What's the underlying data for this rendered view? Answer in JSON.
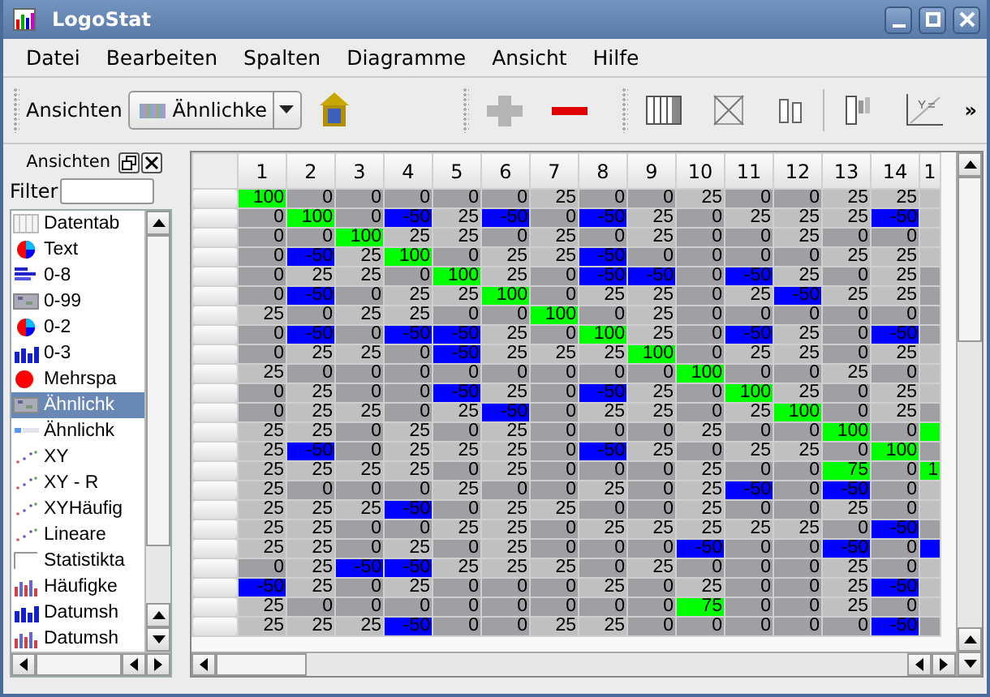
{
  "window": {
    "title": "LogoStat"
  },
  "menu": [
    "Datei",
    "Bearbeiten",
    "Spalten",
    "Diagramme",
    "Ansicht",
    "Hilfe"
  ],
  "toolbar": {
    "label": "Ansichten",
    "combo_value": "Ähnlichke",
    "overflow": "»"
  },
  "panel": {
    "title": "Ansichten",
    "filter_label": "Filter",
    "items": [
      {
        "label": "Datentab",
        "selected": false
      },
      {
        "label": "Text",
        "selected": false
      },
      {
        "label": "0-8",
        "selected": false
      },
      {
        "label": "0-99",
        "selected": false
      },
      {
        "label": "0-2",
        "selected": false
      },
      {
        "label": "0-3",
        "selected": false
      },
      {
        "label": "Mehrspa",
        "selected": false
      },
      {
        "label": "Ähnlichk",
        "selected": true
      },
      {
        "label": "Ähnlichk",
        "selected": false
      },
      {
        "label": "XY",
        "selected": false
      },
      {
        "label": "XY - R",
        "selected": false
      },
      {
        "label": "XYHäufig",
        "selected": false
      },
      {
        "label": "Lineare",
        "selected": false
      },
      {
        "label": "Statistikta",
        "selected": false
      },
      {
        "label": "Häufigke",
        "selected": false
      },
      {
        "label": "Datumsh",
        "selected": false
      },
      {
        "label": "Datumsh",
        "selected": false
      }
    ]
  },
  "table": {
    "columns": [
      "1",
      "2",
      "3",
      "4",
      "5",
      "6",
      "7",
      "8",
      "9",
      "10",
      "11",
      "12",
      "13",
      "14",
      "1"
    ],
    "rows": [
      {
        "cells": [
          {
            "value": "100",
            "color": "#00ff00"
          },
          {
            "value": "0",
            "color": "#a0a0a4"
          },
          {
            "value": "0",
            "color": "#a0a0a4"
          },
          {
            "value": "0",
            "color": "#a0a0a4"
          },
          {
            "value": "0",
            "color": "#a0a0a4"
          },
          {
            "value": "0",
            "color": "#a0a0a4"
          },
          {
            "value": "25",
            "color": "#c0c0c0"
          },
          {
            "value": "0",
            "color": "#a0a0a4"
          },
          {
            "value": "0",
            "color": "#a0a0a4"
          },
          {
            "value": "25",
            "color": "#c0c0c0"
          },
          {
            "value": "0",
            "color": "#a0a0a4"
          },
          {
            "value": "0",
            "color": "#a0a0a4"
          },
          {
            "value": "25",
            "color": "#c0c0c0"
          },
          {
            "value": "25",
            "color": "#c0c0c0"
          },
          {
            "color": "#c0c0c0"
          }
        ]
      },
      {
        "cells": [
          {
            "value": "0",
            "color": "#a0a0a4"
          },
          {
            "value": "100",
            "color": "#00ff00"
          },
          {
            "value": "0",
            "color": "#a0a0a4"
          },
          {
            "value": "-50",
            "color": "#0000ff"
          },
          {
            "value": "25",
            "color": "#c0c0c0"
          },
          {
            "value": "-50",
            "color": "#0000ff"
          },
          {
            "value": "0",
            "color": "#a0a0a4"
          },
          {
            "value": "-50",
            "color": "#0000ff"
          },
          {
            "value": "25",
            "color": "#c0c0c0"
          },
          {
            "value": "0",
            "color": "#a0a0a4"
          },
          {
            "value": "25",
            "color": "#c0c0c0"
          },
          {
            "value": "25",
            "color": "#c0c0c0"
          },
          {
            "value": "25",
            "color": "#c0c0c0"
          },
          {
            "value": "-50",
            "color": "#0000ff"
          },
          {
            "color": "#c0c0c0"
          }
        ]
      },
      {
        "cells": [
          {
            "value": "0",
            "color": "#a0a0a4"
          },
          {
            "value": "0",
            "color": "#a0a0a4"
          },
          {
            "value": "100",
            "color": "#00ff00"
          },
          {
            "value": "25",
            "color": "#c0c0c0"
          },
          {
            "value": "25",
            "color": "#c0c0c0"
          },
          {
            "value": "0",
            "color": "#a0a0a4"
          },
          {
            "value": "25",
            "color": "#c0c0c0"
          },
          {
            "value": "0",
            "color": "#a0a0a4"
          },
          {
            "value": "25",
            "color": "#c0c0c0"
          },
          {
            "value": "0",
            "color": "#a0a0a4"
          },
          {
            "value": "0",
            "color": "#a0a0a4"
          },
          {
            "value": "25",
            "color": "#c0c0c0"
          },
          {
            "value": "0",
            "color": "#a0a0a4"
          },
          {
            "value": "0",
            "color": "#a0a0a4"
          },
          {
            "color": "#c0c0c0"
          }
        ]
      },
      {
        "cells": [
          {
            "value": "0",
            "color": "#a0a0a4"
          },
          {
            "value": "-50",
            "color": "#0000ff"
          },
          {
            "value": "25",
            "color": "#c0c0c0"
          },
          {
            "value": "100",
            "color": "#00ff00"
          },
          {
            "value": "0",
            "color": "#a0a0a4"
          },
          {
            "value": "25",
            "color": "#c0c0c0"
          },
          {
            "value": "25",
            "color": "#c0c0c0"
          },
          {
            "value": "-50",
            "color": "#0000ff"
          },
          {
            "value": "0",
            "color": "#a0a0a4"
          },
          {
            "value": "0",
            "color": "#a0a0a4"
          },
          {
            "value": "0",
            "color": "#a0a0a4"
          },
          {
            "value": "0",
            "color": "#a0a0a4"
          },
          {
            "value": "25",
            "color": "#c0c0c0"
          },
          {
            "value": "25",
            "color": "#c0c0c0"
          },
          {
            "color": "#c0c0c0"
          }
        ]
      },
      {
        "cells": [
          {
            "value": "0",
            "color": "#a0a0a4"
          },
          {
            "value": "25",
            "color": "#c0c0c0"
          },
          {
            "value": "25",
            "color": "#c0c0c0"
          },
          {
            "value": "0",
            "color": "#a0a0a4"
          },
          {
            "value": "100",
            "color": "#00ff00"
          },
          {
            "value": "25",
            "color": "#c0c0c0"
          },
          {
            "value": "0",
            "color": "#a0a0a4"
          },
          {
            "value": "-50",
            "color": "#0000ff"
          },
          {
            "value": "-50",
            "color": "#0000ff"
          },
          {
            "value": "0",
            "color": "#a0a0a4"
          },
          {
            "value": "-50",
            "color": "#0000ff"
          },
          {
            "value": "25",
            "color": "#c0c0c0"
          },
          {
            "value": "0",
            "color": "#a0a0a4"
          },
          {
            "value": "25",
            "color": "#c0c0c0"
          },
          {
            "color": "#a0a0a4"
          }
        ]
      },
      {
        "cells": [
          {
            "value": "0",
            "color": "#a0a0a4"
          },
          {
            "value": "-50",
            "color": "#0000ff"
          },
          {
            "value": "0",
            "color": "#a0a0a4"
          },
          {
            "value": "25",
            "color": "#c0c0c0"
          },
          {
            "value": "25",
            "color": "#c0c0c0"
          },
          {
            "value": "100",
            "color": "#00ff00"
          },
          {
            "value": "0",
            "color": "#a0a0a4"
          },
          {
            "value": "25",
            "color": "#c0c0c0"
          },
          {
            "value": "25",
            "color": "#c0c0c0"
          },
          {
            "value": "0",
            "color": "#a0a0a4"
          },
          {
            "value": "25",
            "color": "#c0c0c0"
          },
          {
            "value": "-50",
            "color": "#0000ff"
          },
          {
            "value": "25",
            "color": "#c0c0c0"
          },
          {
            "value": "25",
            "color": "#c0c0c0"
          },
          {
            "color": "#a0a0a4"
          }
        ]
      },
      {
        "cells": [
          {
            "value": "25",
            "color": "#c0c0c0"
          },
          {
            "value": "0",
            "color": "#a0a0a4"
          },
          {
            "value": "25",
            "color": "#c0c0c0"
          },
          {
            "value": "25",
            "color": "#c0c0c0"
          },
          {
            "value": "0",
            "color": "#a0a0a4"
          },
          {
            "value": "0",
            "color": "#a0a0a4"
          },
          {
            "value": "100",
            "color": "#00ff00"
          },
          {
            "value": "0",
            "color": "#a0a0a4"
          },
          {
            "value": "25",
            "color": "#c0c0c0"
          },
          {
            "value": "0",
            "color": "#a0a0a4"
          },
          {
            "value": "0",
            "color": "#a0a0a4"
          },
          {
            "value": "0",
            "color": "#a0a0a4"
          },
          {
            "value": "0",
            "color": "#a0a0a4"
          },
          {
            "value": "0",
            "color": "#a0a0a4"
          },
          {
            "color": "#a0a0a4"
          }
        ]
      },
      {
        "cells": [
          {
            "value": "0",
            "color": "#a0a0a4"
          },
          {
            "value": "-50",
            "color": "#0000ff"
          },
          {
            "value": "0",
            "color": "#a0a0a4"
          },
          {
            "value": "-50",
            "color": "#0000ff"
          },
          {
            "value": "-50",
            "color": "#0000ff"
          },
          {
            "value": "25",
            "color": "#c0c0c0"
          },
          {
            "value": "0",
            "color": "#a0a0a4"
          },
          {
            "value": "100",
            "color": "#00ff00"
          },
          {
            "value": "25",
            "color": "#c0c0c0"
          },
          {
            "value": "0",
            "color": "#a0a0a4"
          },
          {
            "value": "-50",
            "color": "#0000ff"
          },
          {
            "value": "25",
            "color": "#c0c0c0"
          },
          {
            "value": "0",
            "color": "#a0a0a4"
          },
          {
            "value": "-50",
            "color": "#0000ff"
          },
          {
            "color": "#a0a0a4"
          }
        ]
      },
      {
        "cells": [
          {
            "value": "0",
            "color": "#a0a0a4"
          },
          {
            "value": "25",
            "color": "#c0c0c0"
          },
          {
            "value": "25",
            "color": "#c0c0c0"
          },
          {
            "value": "0",
            "color": "#a0a0a4"
          },
          {
            "value": "-50",
            "color": "#0000ff"
          },
          {
            "value": "25",
            "color": "#c0c0c0"
          },
          {
            "value": "25",
            "color": "#c0c0c0"
          },
          {
            "value": "25",
            "color": "#c0c0c0"
          },
          {
            "value": "100",
            "color": "#00ff00"
          },
          {
            "value": "0",
            "color": "#a0a0a4"
          },
          {
            "value": "25",
            "color": "#c0c0c0"
          },
          {
            "value": "25",
            "color": "#c0c0c0"
          },
          {
            "value": "0",
            "color": "#a0a0a4"
          },
          {
            "value": "25",
            "color": "#c0c0c0"
          },
          {
            "color": "#c0c0c0"
          }
        ]
      },
      {
        "cells": [
          {
            "value": "25",
            "color": "#c0c0c0"
          },
          {
            "value": "0",
            "color": "#a0a0a4"
          },
          {
            "value": "0",
            "color": "#a0a0a4"
          },
          {
            "value": "0",
            "color": "#a0a0a4"
          },
          {
            "value": "0",
            "color": "#a0a0a4"
          },
          {
            "value": "0",
            "color": "#a0a0a4"
          },
          {
            "value": "0",
            "color": "#a0a0a4"
          },
          {
            "value": "0",
            "color": "#a0a0a4"
          },
          {
            "value": "0",
            "color": "#a0a0a4"
          },
          {
            "value": "100",
            "color": "#00ff00"
          },
          {
            "value": "0",
            "color": "#a0a0a4"
          },
          {
            "value": "0",
            "color": "#a0a0a4"
          },
          {
            "value": "25",
            "color": "#c0c0c0"
          },
          {
            "value": "0",
            "color": "#a0a0a4"
          },
          {
            "color": "#c0c0c0"
          }
        ]
      },
      {
        "cells": [
          {
            "value": "0",
            "color": "#a0a0a4"
          },
          {
            "value": "25",
            "color": "#c0c0c0"
          },
          {
            "value": "0",
            "color": "#a0a0a4"
          },
          {
            "value": "0",
            "color": "#a0a0a4"
          },
          {
            "value": "-50",
            "color": "#0000ff"
          },
          {
            "value": "25",
            "color": "#c0c0c0"
          },
          {
            "value": "0",
            "color": "#a0a0a4"
          },
          {
            "value": "-50",
            "color": "#0000ff"
          },
          {
            "value": "25",
            "color": "#c0c0c0"
          },
          {
            "value": "0",
            "color": "#a0a0a4"
          },
          {
            "value": "100",
            "color": "#00ff00"
          },
          {
            "value": "25",
            "color": "#c0c0c0"
          },
          {
            "value": "0",
            "color": "#a0a0a4"
          },
          {
            "value": "25",
            "color": "#c0c0c0"
          },
          {
            "color": "#c0c0c0"
          }
        ]
      },
      {
        "cells": [
          {
            "value": "0",
            "color": "#a0a0a4"
          },
          {
            "value": "25",
            "color": "#c0c0c0"
          },
          {
            "value": "25",
            "color": "#c0c0c0"
          },
          {
            "value": "0",
            "color": "#a0a0a4"
          },
          {
            "value": "25",
            "color": "#c0c0c0"
          },
          {
            "value": "-50",
            "color": "#0000ff"
          },
          {
            "value": "0",
            "color": "#a0a0a4"
          },
          {
            "value": "25",
            "color": "#c0c0c0"
          },
          {
            "value": "25",
            "color": "#c0c0c0"
          },
          {
            "value": "0",
            "color": "#a0a0a4"
          },
          {
            "value": "25",
            "color": "#c0c0c0"
          },
          {
            "value": "100",
            "color": "#00ff00"
          },
          {
            "value": "0",
            "color": "#a0a0a4"
          },
          {
            "value": "25",
            "color": "#c0c0c0"
          },
          {
            "color": "#a0a0a4"
          }
        ]
      },
      {
        "cells": [
          {
            "value": "25",
            "color": "#c0c0c0"
          },
          {
            "value": "25",
            "color": "#c0c0c0"
          },
          {
            "value": "0",
            "color": "#a0a0a4"
          },
          {
            "value": "25",
            "color": "#c0c0c0"
          },
          {
            "value": "0",
            "color": "#a0a0a4"
          },
          {
            "value": "25",
            "color": "#c0c0c0"
          },
          {
            "value": "0",
            "color": "#a0a0a4"
          },
          {
            "value": "0",
            "color": "#a0a0a4"
          },
          {
            "value": "0",
            "color": "#a0a0a4"
          },
          {
            "value": "25",
            "color": "#c0c0c0"
          },
          {
            "value": "0",
            "color": "#a0a0a4"
          },
          {
            "value": "0",
            "color": "#a0a0a4"
          },
          {
            "value": "100",
            "color": "#00ff00"
          },
          {
            "value": "0",
            "color": "#a0a0a4"
          },
          {
            "color": "#00ff00"
          }
        ]
      },
      {
        "cells": [
          {
            "value": "25",
            "color": "#c0c0c0"
          },
          {
            "value": "-50",
            "color": "#0000ff"
          },
          {
            "value": "0",
            "color": "#a0a0a4"
          },
          {
            "value": "25",
            "color": "#c0c0c0"
          },
          {
            "value": "25",
            "color": "#c0c0c0"
          },
          {
            "value": "25",
            "color": "#c0c0c0"
          },
          {
            "value": "0",
            "color": "#a0a0a4"
          },
          {
            "value": "-50",
            "color": "#0000ff"
          },
          {
            "value": "25",
            "color": "#c0c0c0"
          },
          {
            "value": "0",
            "color": "#a0a0a4"
          },
          {
            "value": "25",
            "color": "#c0c0c0"
          },
          {
            "value": "25",
            "color": "#c0c0c0"
          },
          {
            "value": "0",
            "color": "#a0a0a4"
          },
          {
            "value": "100",
            "color": "#00ff00"
          },
          {
            "color": "#a0a0a4"
          }
        ]
      },
      {
        "cells": [
          {
            "value": "25",
            "color": "#c0c0c0"
          },
          {
            "value": "25",
            "color": "#c0c0c0"
          },
          {
            "value": "25",
            "color": "#c0c0c0"
          },
          {
            "value": "25",
            "color": "#c0c0c0"
          },
          {
            "value": "0",
            "color": "#a0a0a4"
          },
          {
            "value": "25",
            "color": "#c0c0c0"
          },
          {
            "value": "0",
            "color": "#a0a0a4"
          },
          {
            "value": "0",
            "color": "#a0a0a4"
          },
          {
            "value": "0",
            "color": "#a0a0a4"
          },
          {
            "value": "25",
            "color": "#c0c0c0"
          },
          {
            "value": "0",
            "color": "#a0a0a4"
          },
          {
            "value": "0",
            "color": "#a0a0a4"
          },
          {
            "value": "75",
            "color": "#00ff00"
          },
          {
            "value": "0",
            "color": "#a0a0a4"
          },
          {
            "value": "1",
            "color": "#00ff00"
          }
        ]
      },
      {
        "cells": [
          {
            "value": "25",
            "color": "#c0c0c0"
          },
          {
            "value": "0",
            "color": "#a0a0a4"
          },
          {
            "value": "0",
            "color": "#a0a0a4"
          },
          {
            "value": "0",
            "color": "#a0a0a4"
          },
          {
            "value": "25",
            "color": "#c0c0c0"
          },
          {
            "value": "0",
            "color": "#a0a0a4"
          },
          {
            "value": "0",
            "color": "#a0a0a4"
          },
          {
            "value": "25",
            "color": "#c0c0c0"
          },
          {
            "value": "0",
            "color": "#a0a0a4"
          },
          {
            "value": "25",
            "color": "#c0c0c0"
          },
          {
            "value": "-50",
            "color": "#0000ff"
          },
          {
            "value": "0",
            "color": "#a0a0a4"
          },
          {
            "value": "-50",
            "color": "#0000ff"
          },
          {
            "value": "0",
            "color": "#a0a0a4"
          },
          {
            "color": "#c0c0c0"
          }
        ]
      },
      {
        "cells": [
          {
            "value": "25",
            "color": "#c0c0c0"
          },
          {
            "value": "25",
            "color": "#c0c0c0"
          },
          {
            "value": "25",
            "color": "#c0c0c0"
          },
          {
            "value": "-50",
            "color": "#0000ff"
          },
          {
            "value": "0",
            "color": "#a0a0a4"
          },
          {
            "value": "25",
            "color": "#c0c0c0"
          },
          {
            "value": "25",
            "color": "#c0c0c0"
          },
          {
            "value": "0",
            "color": "#a0a0a4"
          },
          {
            "value": "0",
            "color": "#a0a0a4"
          },
          {
            "value": "25",
            "color": "#c0c0c0"
          },
          {
            "value": "0",
            "color": "#a0a0a4"
          },
          {
            "value": "0",
            "color": "#a0a0a4"
          },
          {
            "value": "25",
            "color": "#c0c0c0"
          },
          {
            "value": "0",
            "color": "#a0a0a4"
          },
          {
            "color": "#c0c0c0"
          }
        ]
      },
      {
        "cells": [
          {
            "value": "25",
            "color": "#c0c0c0"
          },
          {
            "value": "25",
            "color": "#c0c0c0"
          },
          {
            "value": "0",
            "color": "#a0a0a4"
          },
          {
            "value": "0",
            "color": "#a0a0a4"
          },
          {
            "value": "25",
            "color": "#c0c0c0"
          },
          {
            "value": "25",
            "color": "#c0c0c0"
          },
          {
            "value": "0",
            "color": "#a0a0a4"
          },
          {
            "value": "25",
            "color": "#c0c0c0"
          },
          {
            "value": "25",
            "color": "#c0c0c0"
          },
          {
            "value": "25",
            "color": "#c0c0c0"
          },
          {
            "value": "25",
            "color": "#c0c0c0"
          },
          {
            "value": "25",
            "color": "#c0c0c0"
          },
          {
            "value": "0",
            "color": "#a0a0a4"
          },
          {
            "value": "-50",
            "color": "#0000ff"
          },
          {
            "color": "#a0a0a4"
          }
        ]
      },
      {
        "cells": [
          {
            "value": "25",
            "color": "#c0c0c0"
          },
          {
            "value": "25",
            "color": "#c0c0c0"
          },
          {
            "value": "0",
            "color": "#a0a0a4"
          },
          {
            "value": "25",
            "color": "#c0c0c0"
          },
          {
            "value": "0",
            "color": "#a0a0a4"
          },
          {
            "value": "25",
            "color": "#c0c0c0"
          },
          {
            "value": "0",
            "color": "#a0a0a4"
          },
          {
            "value": "0",
            "color": "#a0a0a4"
          },
          {
            "value": "0",
            "color": "#a0a0a4"
          },
          {
            "value": "-50",
            "color": "#0000ff"
          },
          {
            "value": "0",
            "color": "#a0a0a4"
          },
          {
            "value": "0",
            "color": "#a0a0a4"
          },
          {
            "value": "-50",
            "color": "#0000ff"
          },
          {
            "value": "0",
            "color": "#a0a0a4"
          },
          {
            "color": "#0000ff"
          }
        ]
      },
      {
        "cells": [
          {
            "value": "0",
            "color": "#a0a0a4"
          },
          {
            "value": "25",
            "color": "#c0c0c0"
          },
          {
            "value": "-50",
            "color": "#0000ff"
          },
          {
            "value": "-50",
            "color": "#0000ff"
          },
          {
            "value": "25",
            "color": "#c0c0c0"
          },
          {
            "value": "25",
            "color": "#c0c0c0"
          },
          {
            "value": "25",
            "color": "#c0c0c0"
          },
          {
            "value": "0",
            "color": "#a0a0a4"
          },
          {
            "value": "25",
            "color": "#c0c0c0"
          },
          {
            "value": "0",
            "color": "#a0a0a4"
          },
          {
            "value": "0",
            "color": "#a0a0a4"
          },
          {
            "value": "0",
            "color": "#a0a0a4"
          },
          {
            "value": "25",
            "color": "#c0c0c0"
          },
          {
            "value": "0",
            "color": "#a0a0a4"
          },
          {
            "color": "#c0c0c0"
          }
        ]
      },
      {
        "cells": [
          {
            "value": "-50",
            "color": "#0000ff"
          },
          {
            "value": "25",
            "color": "#c0c0c0"
          },
          {
            "value": "0",
            "color": "#a0a0a4"
          },
          {
            "value": "25",
            "color": "#c0c0c0"
          },
          {
            "value": "0",
            "color": "#a0a0a4"
          },
          {
            "value": "0",
            "color": "#a0a0a4"
          },
          {
            "value": "0",
            "color": "#a0a0a4"
          },
          {
            "value": "25",
            "color": "#c0c0c0"
          },
          {
            "value": "0",
            "color": "#a0a0a4"
          },
          {
            "value": "25",
            "color": "#c0c0c0"
          },
          {
            "value": "0",
            "color": "#a0a0a4"
          },
          {
            "value": "0",
            "color": "#a0a0a4"
          },
          {
            "value": "25",
            "color": "#c0c0c0"
          },
          {
            "value": "-50",
            "color": "#0000ff"
          },
          {
            "color": "#c0c0c0"
          }
        ]
      },
      {
        "cells": [
          {
            "value": "25",
            "color": "#c0c0c0"
          },
          {
            "value": "0",
            "color": "#a0a0a4"
          },
          {
            "value": "0",
            "color": "#a0a0a4"
          },
          {
            "value": "0",
            "color": "#a0a0a4"
          },
          {
            "value": "0",
            "color": "#a0a0a4"
          },
          {
            "value": "0",
            "color": "#a0a0a4"
          },
          {
            "value": "0",
            "color": "#a0a0a4"
          },
          {
            "value": "0",
            "color": "#a0a0a4"
          },
          {
            "value": "0",
            "color": "#a0a0a4"
          },
          {
            "value": "75",
            "color": "#00ff00"
          },
          {
            "value": "0",
            "color": "#a0a0a4"
          },
          {
            "value": "0",
            "color": "#a0a0a4"
          },
          {
            "value": "25",
            "color": "#c0c0c0"
          },
          {
            "value": "0",
            "color": "#a0a0a4"
          },
          {
            "color": "#c0c0c0"
          }
        ]
      },
      {
        "cells": [
          {
            "value": "25",
            "color": "#c0c0c0"
          },
          {
            "value": "25",
            "color": "#c0c0c0"
          },
          {
            "value": "25",
            "color": "#c0c0c0"
          },
          {
            "value": "-50",
            "color": "#0000ff"
          },
          {
            "value": "0",
            "color": "#a0a0a4"
          },
          {
            "value": "0",
            "color": "#a0a0a4"
          },
          {
            "value": "25",
            "color": "#c0c0c0"
          },
          {
            "value": "25",
            "color": "#c0c0c0"
          },
          {
            "value": "0",
            "color": "#a0a0a4"
          },
          {
            "value": "0",
            "color": "#a0a0a4"
          },
          {
            "value": "0",
            "color": "#a0a0a4"
          },
          {
            "value": "0",
            "color": "#a0a0a4"
          },
          {
            "value": "0",
            "color": "#a0a0a4"
          },
          {
            "value": "-50",
            "color": "#0000ff"
          },
          {
            "color": "#a0a0a4"
          }
        ]
      }
    ]
  }
}
